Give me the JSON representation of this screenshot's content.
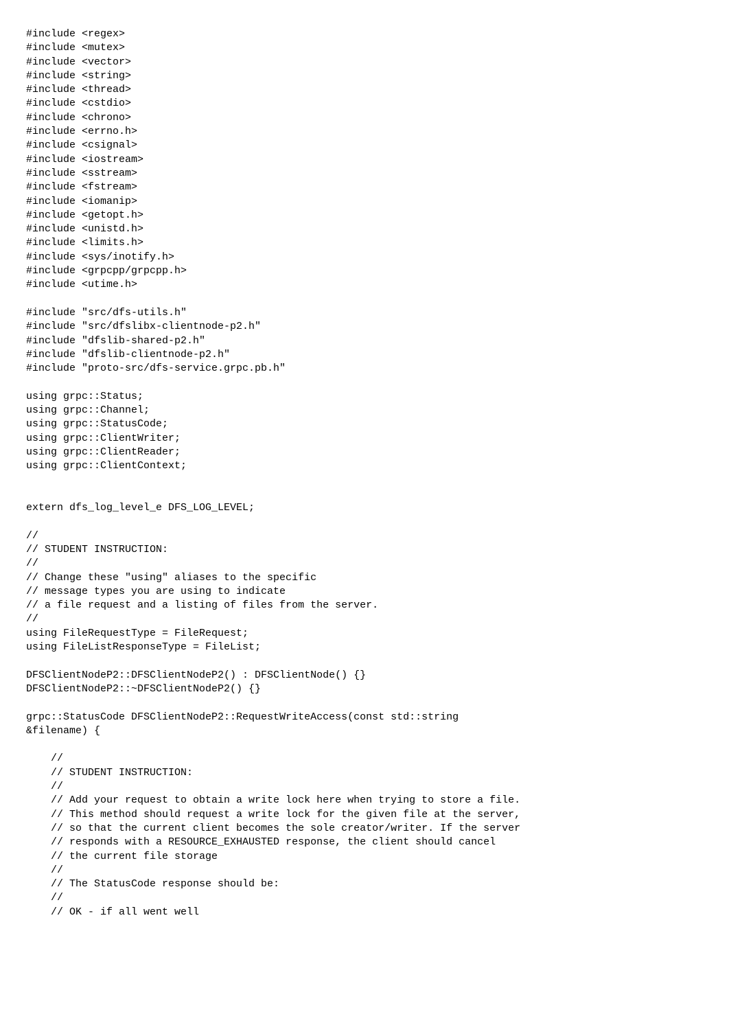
{
  "code_lines": [
    "#include <regex>",
    "#include <mutex>",
    "#include <vector>",
    "#include <string>",
    "#include <thread>",
    "#include <cstdio>",
    "#include <chrono>",
    "#include <errno.h>",
    "#include <csignal>",
    "#include <iostream>",
    "#include <sstream>",
    "#include <fstream>",
    "#include <iomanip>",
    "#include <getopt.h>",
    "#include <unistd.h>",
    "#include <limits.h>",
    "#include <sys/inotify.h>",
    "#include <grpcpp/grpcpp.h>",
    "#include <utime.h>",
    "",
    "#include \"src/dfs-utils.h\"",
    "#include \"src/dfslibx-clientnode-p2.h\"",
    "#include \"dfslib-shared-p2.h\"",
    "#include \"dfslib-clientnode-p2.h\"",
    "#include \"proto-src/dfs-service.grpc.pb.h\"",
    "",
    "using grpc::Status;",
    "using grpc::Channel;",
    "using grpc::StatusCode;",
    "using grpc::ClientWriter;",
    "using grpc::ClientReader;",
    "using grpc::ClientContext;",
    "",
    "",
    "extern dfs_log_level_e DFS_LOG_LEVEL;",
    "",
    "//",
    "// STUDENT INSTRUCTION:",
    "//",
    "// Change these \"using\" aliases to the specific",
    "// message types you are using to indicate",
    "// a file request and a listing of files from the server.",
    "//",
    "using FileRequestType = FileRequest;",
    "using FileListResponseType = FileList;",
    "",
    "DFSClientNodeP2::DFSClientNodeP2() : DFSClientNode() {}",
    "DFSClientNodeP2::~DFSClientNodeP2() {}",
    "",
    "grpc::StatusCode DFSClientNodeP2::RequestWriteAccess(const std::string ",
    "&filename) {",
    "",
    "    //",
    "    // STUDENT INSTRUCTION:",
    "    //",
    "    // Add your request to obtain a write lock here when trying to store a file.",
    "    // This method should request a write lock for the given file at the server,",
    "    // so that the current client becomes the sole creator/writer. If the server",
    "    // responds with a RESOURCE_EXHAUSTED response, the client should cancel",
    "    // the current file storage",
    "    //",
    "    // The StatusCode response should be:",
    "    //",
    "    // OK - if all went well"
  ]
}
